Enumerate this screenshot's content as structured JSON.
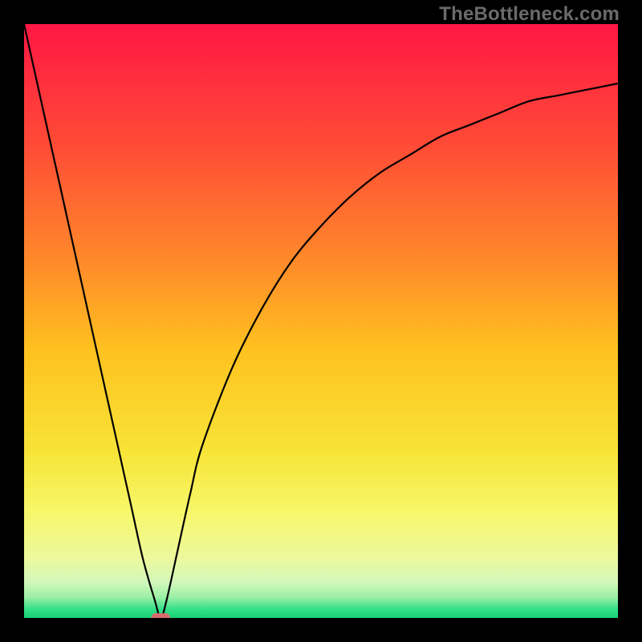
{
  "watermark": "TheBottleneck.com",
  "chart_data": {
    "type": "line",
    "title": "",
    "xlabel": "",
    "ylabel": "",
    "xlim": [
      0,
      100
    ],
    "ylim": [
      0,
      100
    ],
    "grid": false,
    "legend": false,
    "series": [
      {
        "name": "bottleneck-curve",
        "x": [
          0,
          2,
          4,
          6,
          8,
          10,
          12,
          14,
          16,
          18,
          20,
          22,
          23,
          24,
          26,
          28,
          30,
          35,
          40,
          45,
          50,
          55,
          60,
          65,
          70,
          75,
          80,
          85,
          90,
          95,
          100
        ],
        "values": [
          100,
          91,
          82,
          73,
          64,
          55,
          46,
          37,
          28,
          19,
          10,
          3,
          0,
          3,
          12,
          21,
          29,
          42,
          52,
          60,
          66,
          71,
          75,
          78,
          81,
          83,
          85,
          87,
          88,
          89,
          90
        ]
      }
    ],
    "marker": {
      "name": "optimal-marker",
      "x": 23,
      "y": 0,
      "color": "#d86d6d",
      "width": 3.2,
      "height": 1.6
    },
    "gradient_stops": [
      {
        "pos": 0.0,
        "color": "#ff1744"
      },
      {
        "pos": 0.2,
        "color": "#ff4a36"
      },
      {
        "pos": 0.4,
        "color": "#ff8a2a"
      },
      {
        "pos": 0.55,
        "color": "#ffc21f"
      },
      {
        "pos": 0.72,
        "color": "#f7e437"
      },
      {
        "pos": 0.82,
        "color": "#f7f769"
      },
      {
        "pos": 0.9,
        "color": "#ecf99d"
      },
      {
        "pos": 0.94,
        "color": "#d2f8bb"
      },
      {
        "pos": 0.965,
        "color": "#9cf0a6"
      },
      {
        "pos": 0.985,
        "color": "#34e189"
      },
      {
        "pos": 1.0,
        "color": "#17d277"
      }
    ]
  }
}
